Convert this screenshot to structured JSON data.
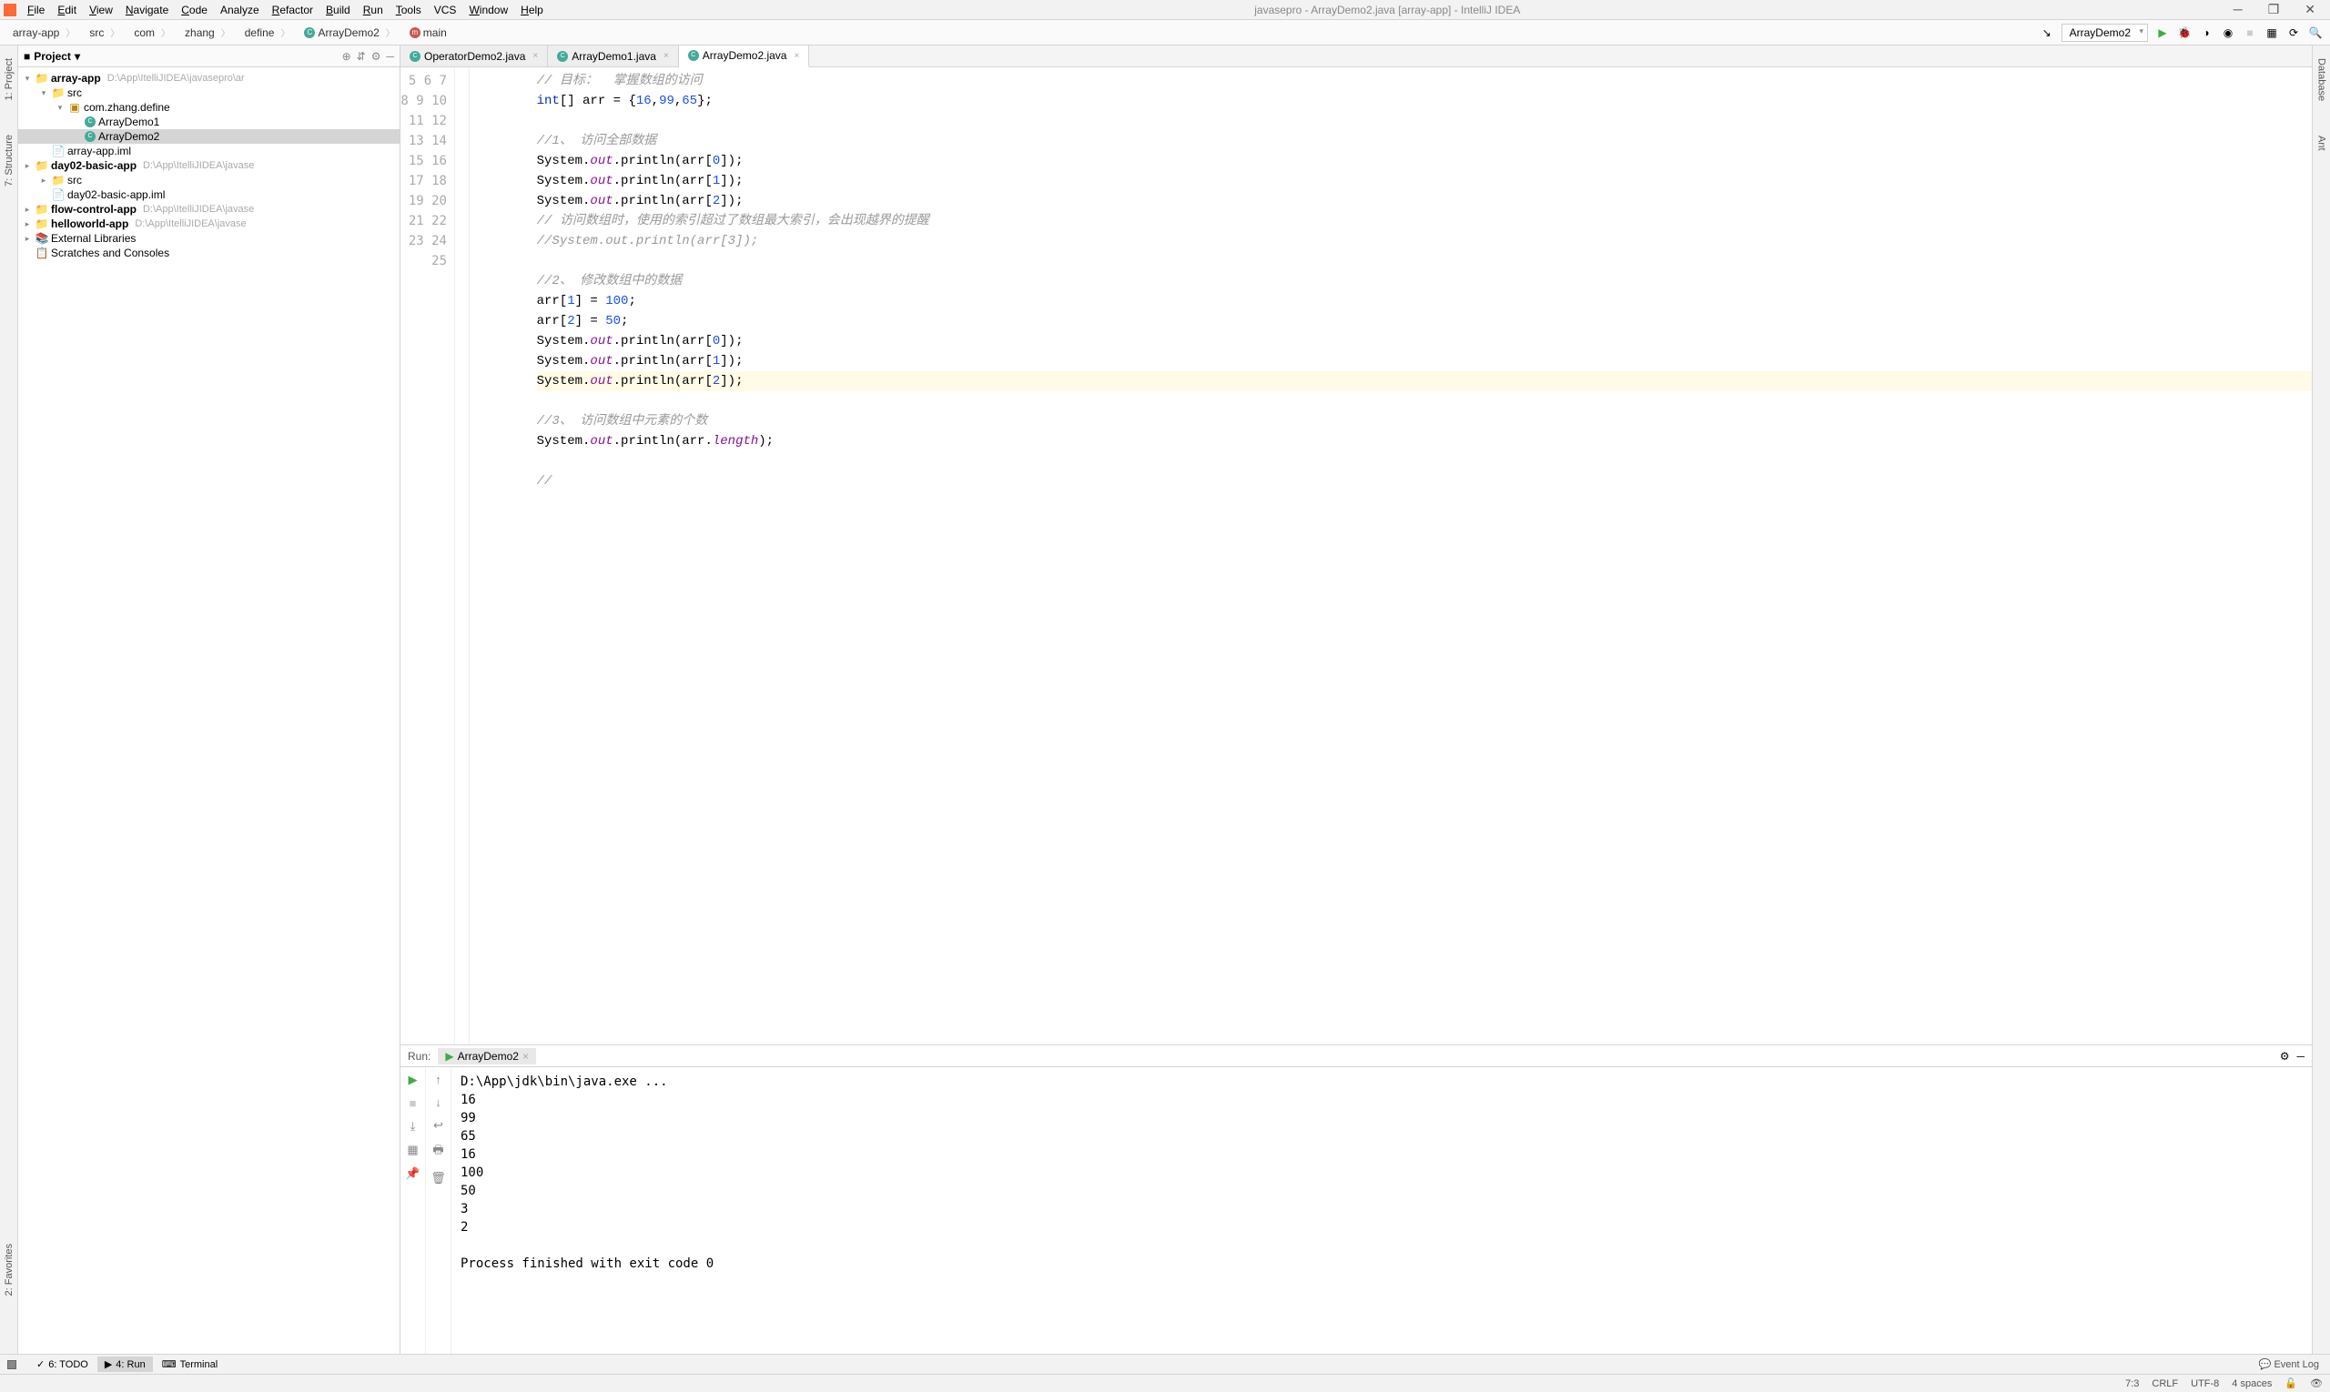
{
  "title": "javasepro - ArrayDemo2.java [array-app] - IntelliJ IDEA",
  "menu": [
    "File",
    "Edit",
    "View",
    "Navigate",
    "Code",
    "Analyze",
    "Refactor",
    "Build",
    "Run",
    "Tools",
    "VCS",
    "Window",
    "Help"
  ],
  "menu_underline": [
    "F",
    "E",
    "V",
    "N",
    "C",
    "",
    "R",
    "B",
    "R",
    "T",
    "",
    "W",
    "H"
  ],
  "breadcrumbs": [
    "array-app",
    "src",
    "com",
    "zhang",
    "define",
    "ArrayDemo2",
    "main"
  ],
  "run_config": "ArrayDemo2",
  "left_tabs": [
    "1: Project",
    "7: Structure",
    "2: Favorites"
  ],
  "right_tabs": [
    "Database",
    "Ant"
  ],
  "project": {
    "header": "Project",
    "tree": [
      {
        "depth": 0,
        "arrow": "▾",
        "icon": "folder",
        "label": "array-app",
        "hint": "D:\\App\\ItelliJIDEA\\javasepro\\ar",
        "bold": true
      },
      {
        "depth": 1,
        "arrow": "▾",
        "icon": "folder",
        "label": "src"
      },
      {
        "depth": 2,
        "arrow": "▾",
        "icon": "pkg",
        "label": "com.zhang.define"
      },
      {
        "depth": 3,
        "arrow": "",
        "icon": "class",
        "label": "ArrayDemo1"
      },
      {
        "depth": 3,
        "arrow": "",
        "icon": "class",
        "label": "ArrayDemo2",
        "selected": true
      },
      {
        "depth": 1,
        "arrow": "",
        "icon": "file",
        "label": "array-app.iml"
      },
      {
        "depth": 0,
        "arrow": "▸",
        "icon": "folder",
        "label": "day02-basic-app",
        "hint": "D:\\App\\ItelliJIDEA\\javase",
        "bold": true
      },
      {
        "depth": 1,
        "arrow": "▸",
        "icon": "folder",
        "label": "src"
      },
      {
        "depth": 1,
        "arrow": "",
        "icon": "file",
        "label": "day02-basic-app.iml"
      },
      {
        "depth": 0,
        "arrow": "▸",
        "icon": "folder",
        "label": "flow-control-app",
        "hint": "D:\\App\\ItelliJIDEA\\javase",
        "bold": true
      },
      {
        "depth": 0,
        "arrow": "▸",
        "icon": "folder",
        "label": "helloworld-app",
        "hint": "D:\\App\\ItelliJIDEA\\javase",
        "bold": true
      },
      {
        "depth": 0,
        "arrow": "▸",
        "icon": "lib",
        "label": "External Libraries"
      },
      {
        "depth": 0,
        "arrow": "",
        "icon": "scratch",
        "label": "Scratches and Consoles"
      }
    ]
  },
  "tabs": [
    {
      "label": "OperatorDemo2.java",
      "active": false
    },
    {
      "label": "ArrayDemo1.java",
      "active": false
    },
    {
      "label": "ArrayDemo2.java",
      "active": true
    }
  ],
  "gutter_start": 5,
  "gutter_end": 25,
  "code_lines": [
    {
      "n": 5,
      "html": "<span class='cm'>// 目标：  掌握数组的访问</span>"
    },
    {
      "n": 6,
      "html": "<span class='kw'>int</span>[] arr = {<span class='num'>16</span>,<span class='num'>99</span>,<span class='num'>65</span>};"
    },
    {
      "n": 7,
      "html": ""
    },
    {
      "n": 8,
      "html": "<span class='cm'>//1、 访问全部数据</span>"
    },
    {
      "n": 9,
      "html": "System.<span class='fld'>out</span>.println(arr[<span class='num'>0</span>]);"
    },
    {
      "n": 10,
      "html": "System.<span class='fld'>out</span>.println(arr[<span class='num'>1</span>]);"
    },
    {
      "n": 11,
      "html": "System.<span class='fld'>out</span>.println(arr[<span class='num'>2</span>]);"
    },
    {
      "n": 12,
      "html": "<span class='cm'>// 访问数组时，使用的索引超过了数组最大索引，会出现越界的提醒</span>"
    },
    {
      "n": 13,
      "html": "<span class='cm'>//System.out.println(arr[3]);</span>"
    },
    {
      "n": 14,
      "html": ""
    },
    {
      "n": 15,
      "html": "<span class='cm'>//2、 修改数组中的数据</span>"
    },
    {
      "n": 16,
      "html": "arr[<span class='num'>1</span>] = <span class='num'>100</span>;"
    },
    {
      "n": 17,
      "html": "arr[<span class='num'>2</span>] = <span class='num'>50</span>;"
    },
    {
      "n": 18,
      "html": "System.<span class='fld'>out</span>.println(arr[<span class='num'>0</span>]);"
    },
    {
      "n": 19,
      "html": "System.<span class='fld'>out</span>.println(arr[<span class='num'>1</span>]);"
    },
    {
      "n": 20,
      "html": "System.<span class='fld'>out</span>.println(arr[<span class='num'>2</span>]);",
      "hl": true
    },
    {
      "n": 21,
      "html": ""
    },
    {
      "n": 22,
      "html": "<span class='cm'>//3、 访问数组中元素的个数</span>"
    },
    {
      "n": 23,
      "html": "System.<span class='fld'>out</span>.println(arr.<span class='fld'>length</span>);"
    },
    {
      "n": 24,
      "html": ""
    },
    {
      "n": 25,
      "html": "<span class='cm'>// </span>"
    }
  ],
  "run": {
    "label": "Run:",
    "tab": "ArrayDemo2",
    "output": "D:\\App\\jdk\\bin\\java.exe ...\n16\n99\n65\n16\n100\n50\n3\n2\n\nProcess finished with exit code 0"
  },
  "bottom_tabs": [
    {
      "label": "6: TODO",
      "icon": "✓"
    },
    {
      "label": "4: Run",
      "icon": "▶",
      "active": true
    },
    {
      "label": "Terminal",
      "icon": "⌨"
    }
  ],
  "event_log": "Event Log",
  "status": {
    "pos": "7:3",
    "sep": "CRLF",
    "enc": "UTF-8",
    "indent": "4 spaces"
  }
}
